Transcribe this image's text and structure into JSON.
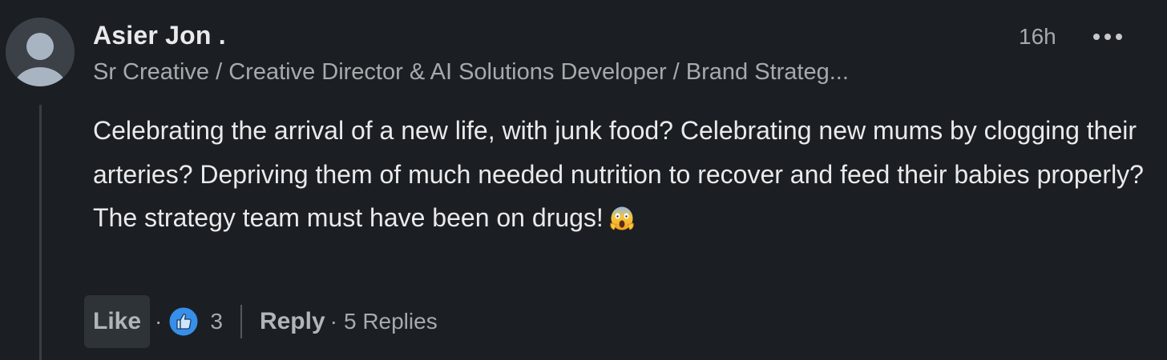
{
  "comment": {
    "author_name": "Asier Jon .",
    "author_headline": "Sr Creative / Creative Director & AI Solutions Developer / Brand Strateg...",
    "timestamp": "16h",
    "body": "Celebrating the arrival of a new life, with junk food? Celebrating new mums by clogging their arteries? Depriving them of much needed nutrition to recover and feed their babies properly? The strategy team must have been on drugs!",
    "body_emoji": "face-screaming-in-fear-icon"
  },
  "actions": {
    "like_label": "Like",
    "separator": "·",
    "reaction_icon": "thumbs-up-like-icon",
    "reaction_count": "3",
    "reply_label": "Reply",
    "replies_label": "5 Replies"
  },
  "colors": {
    "background": "#1b1f23",
    "primary_text": "#e9eaeb",
    "secondary_text": "#a7aaad",
    "like_blue": "#378fe9",
    "button_bg": "#2e3338"
  }
}
